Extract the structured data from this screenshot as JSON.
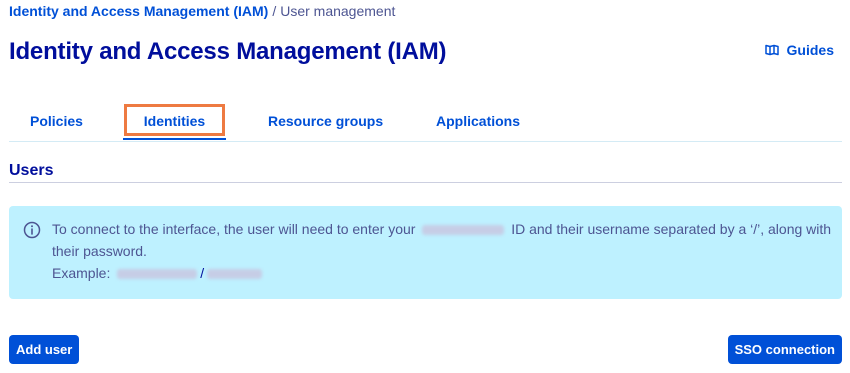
{
  "breadcrumb": {
    "parent": "Identity and Access Management (IAM)",
    "separator": "/",
    "current": "User management"
  },
  "header": {
    "title": "Identity and Access Management (IAM)",
    "guides_label": "Guides",
    "guides_icon": "book-open-icon"
  },
  "tabs": [
    {
      "label": "Policies",
      "active": false
    },
    {
      "label": "Identities",
      "active": true,
      "highlighted": true
    },
    {
      "label": "Resource groups",
      "active": false
    },
    {
      "label": "Applications",
      "active": false
    }
  ],
  "users_section": {
    "title": "Users",
    "info": {
      "icon": "info-circle-icon",
      "text_before": "To connect to the interface, the user will need to enter your",
      "text_after": "ID and their username separated by a ‘/’, along with their password.",
      "example_label": "Example:",
      "example_separator": "/"
    }
  },
  "actions": {
    "add_user_label": "Add user",
    "sso_label": "SSO connection"
  },
  "colors": {
    "brand_primary": "#0050d7",
    "title_dark": "#000e9c",
    "muted_text": "#4d5592",
    "info_background": "#bef1ff",
    "tab_highlight": "#ee7a41"
  }
}
